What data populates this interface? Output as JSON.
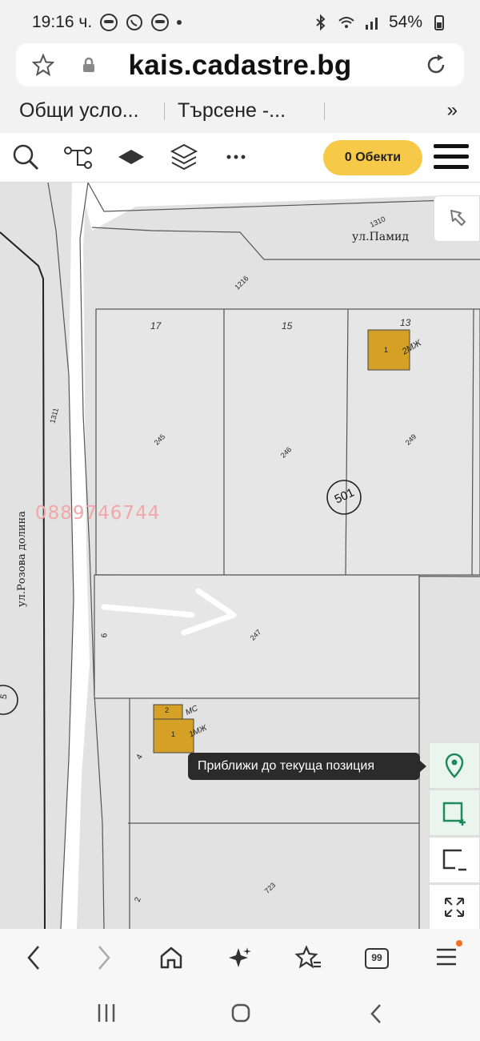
{
  "status": {
    "time": "19:16 ч.",
    "battery": "54%"
  },
  "browser": {
    "url": "kais.cadastre.bg",
    "bookmarks": [
      "Общи усло...",
      "Търсене -..."
    ],
    "more_bookmarks": "»",
    "tab_count": "99"
  },
  "toolbar": {
    "objects_label": "0 Обекти",
    "icons": [
      "search-icon",
      "route-icon",
      "layer-icon",
      "layers-stack-icon",
      "more-icon",
      "menu-icon"
    ]
  },
  "map": {
    "streets": [
      "ул.Памид",
      "ул.Розова долина"
    ],
    "parcel_labels": [
      "1310",
      "1216",
      "17",
      "15",
      "13",
      "1311",
      "245",
      "246",
      "249",
      "501",
      "6",
      "247",
      "4",
      "723",
      "2",
      "5"
    ],
    "building_labels": [
      "1",
      "2МЖ",
      "2",
      "МС",
      "1",
      "1МЖ"
    ],
    "watermark": "0889746744",
    "tooltip": "Приближи до текуща позиция",
    "accent_color": "#1f8a5b",
    "building_color": "#d4a026"
  }
}
